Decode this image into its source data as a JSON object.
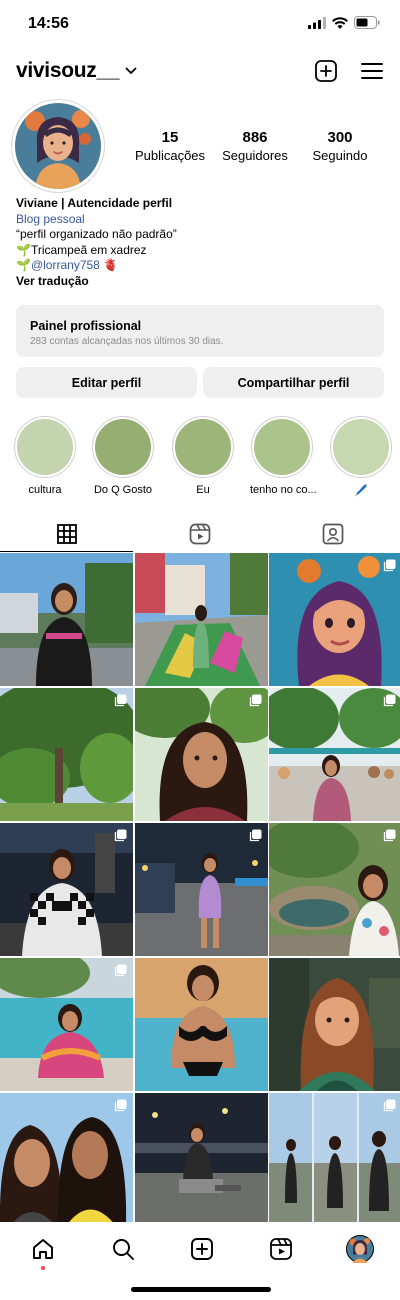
{
  "status_bar": {
    "time": "14:56"
  },
  "header": {
    "username": "vivisouz__",
    "icons": [
      "chevron-down-icon",
      "new-post-icon",
      "menu-icon"
    ]
  },
  "profile": {
    "stats": [
      {
        "value": "15",
        "label": "Publicações"
      },
      {
        "value": "886",
        "label": "Seguidores"
      },
      {
        "value": "300",
        "label": "Seguindo"
      }
    ],
    "bio": {
      "name": "Viviane | Autencidade perfil",
      "category": "Blog pessoal",
      "line1": "“perfil organizado não padrão”",
      "line2": "🌱Tricampeã em xadrez",
      "line3_prefix": "🌱",
      "mention": "@lorrany758",
      "line3_suffix": " 🫀",
      "translate": "Ver tradução"
    }
  },
  "professional_panel": {
    "title": "Painel profissional",
    "subtitle": "283 contas alcançadas nos últimos 30 dias."
  },
  "buttons": {
    "edit": "Editar perfil",
    "share": "Compartilhar perfil"
  },
  "highlights": [
    {
      "label": "cultura",
      "color": "#c3d4ae"
    },
    {
      "label": "Do Q Gosto",
      "color": "#95ae72"
    },
    {
      "label": "Eu",
      "color": "#9cb578"
    },
    {
      "label": "tenho no co...",
      "color": "#aac48c"
    },
    {
      "label": "🖊️",
      "color": "#c6d8b0"
    }
  ],
  "tabs": [
    "grid-icon",
    "reels-icon",
    "tagged-icon"
  ],
  "posts": [
    {
      "scene": "photo of woman in black t-shirt outdoors",
      "multi": false
    },
    {
      "scene": "photo of woman on colorful street carpet",
      "multi": false
    },
    {
      "scene": "illustrated cartoon girl with flowers",
      "multi": true
    },
    {
      "scene": "photo of trees in a park",
      "multi": true
    },
    {
      "scene": "selfie under trees",
      "multi": true
    },
    {
      "scene": "photo at an outdoor crowd",
      "multi": true
    },
    {
      "scene": "woman in checkered top at night",
      "multi": true
    },
    {
      "scene": "woman in purple outfit on street at night",
      "multi": true
    },
    {
      "scene": "woman by a rock pool",
      "multi": true
    },
    {
      "scene": "woman at a swimming pool",
      "multi": true
    },
    {
      "scene": "woman in swimsuit in pool",
      "multi": false
    },
    {
      "scene": "illustrated character in green",
      "multi": false
    },
    {
      "scene": "two women selfie",
      "multi": true
    },
    {
      "scene": "woman on bench at night",
      "multi": false
    },
    {
      "scene": "three photos of woman on road",
      "multi": true
    }
  ],
  "bottom_nav": [
    "home-icon",
    "search-icon",
    "create-icon",
    "reels-icon",
    "profile-avatar"
  ],
  "colors": {
    "link": "#385898",
    "panel_bg": "#efefef",
    "notification": "#ed4956"
  }
}
